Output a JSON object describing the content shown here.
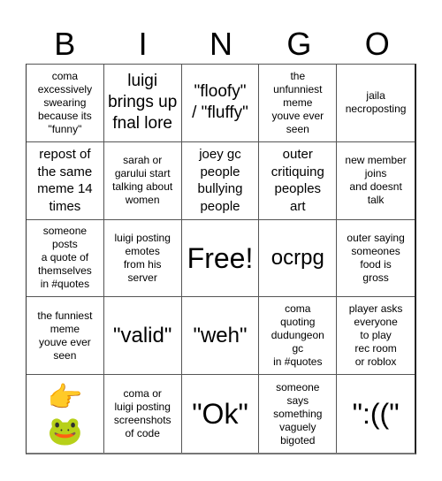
{
  "header": {
    "letters": [
      "B",
      "I",
      "N",
      "G",
      "O"
    ]
  },
  "cells": [
    {
      "text": "coma\nexcessively\nswearing\nbecause its\n\"funny\"",
      "size": "s1"
    },
    {
      "text": "luigi\nbrings up\nfnal lore",
      "size": "s3"
    },
    {
      "text": "\"floofy\"\n/ \"fluffy\"",
      "size": "s3"
    },
    {
      "text": "the\nunfunniest\nmeme\nyouve ever\nseen",
      "size": "s1"
    },
    {
      "text": "jaila\nnecroposting",
      "size": "s1"
    },
    {
      "text": "repost of\nthe same\nmeme 14\ntimes",
      "size": "s2"
    },
    {
      "text": "sarah or\ngarului start\ntalking about\nwomen",
      "size": "s1"
    },
    {
      "text": "joey gc\npeople\nbullying\npeople",
      "size": "s2"
    },
    {
      "text": "outer\ncritiquing\npeoples\nart",
      "size": "s2"
    },
    {
      "text": "new member\njoins\nand doesnt\ntalk",
      "size": "s1"
    },
    {
      "text": "someone\nposts\na quote of\nthemselves\nin #quotes",
      "size": "s1"
    },
    {
      "text": "luigi posting\nemotes\nfrom his\nserver",
      "size": "s1"
    },
    {
      "text": "Free!",
      "size": "s5"
    },
    {
      "text": "ocrpg",
      "size": "s4"
    },
    {
      "text": "outer saying\nsomeones\nfood is\ngross",
      "size": "s1"
    },
    {
      "text": "the funniest\nmeme\nyouve ever\nseen",
      "size": "s1"
    },
    {
      "text": "\"valid\"",
      "size": "s4"
    },
    {
      "text": "\"weh\"",
      "size": "s4"
    },
    {
      "text": "coma\nquoting\ndudungeon\ngc\nin #quotes",
      "size": "s1"
    },
    {
      "text": "player asks\neveryone\nto play\nrec room\nor roblox",
      "size": "s1"
    },
    {
      "text": "👉\n🐸",
      "size": "emoji"
    },
    {
      "text": "coma or\nluigi posting\nscreenshots\nof code",
      "size": "s1"
    },
    {
      "text": "\"Ok\"",
      "size": "s5"
    },
    {
      "text": "someone\nsays\nsomething\nvaguely\nbigoted",
      "size": "s1"
    },
    {
      "text": "\":((\"",
      "size": "s5"
    }
  ]
}
